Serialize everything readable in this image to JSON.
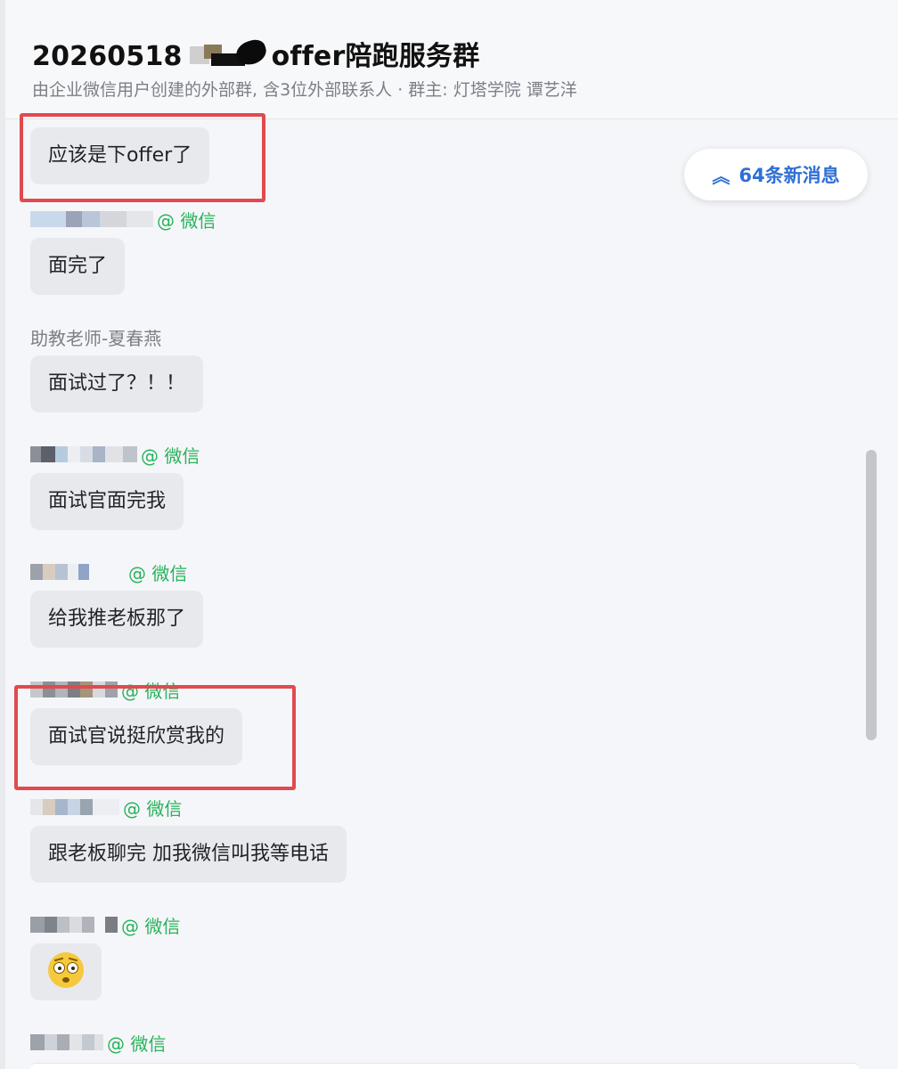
{
  "header": {
    "title_prefix": "20260518",
    "title_suffix": "offer陪跑服务群",
    "subtitle": "由企业微信用户创建的外部群, 含3位外部联系人 · 群主: 灯塔学院 谭艺洋"
  },
  "new_messages_button": {
    "label": "64条新消息",
    "icon": "double-chevron-up-icon"
  },
  "messages": [
    {
      "sender": "",
      "tag": "",
      "text": "应该是下offer了"
    },
    {
      "sender": "",
      "tag": "@ 微信",
      "text": "面完了"
    },
    {
      "sender": "助教老师-夏春燕",
      "tag": "",
      "text": "面试过了？！！"
    },
    {
      "sender": "",
      "tag": "@ 微信",
      "text": "面试官面完我"
    },
    {
      "sender": "",
      "tag": "@ 微信",
      "text": "给我推老板那了"
    },
    {
      "sender": "",
      "tag": "@ 微信",
      "text": "面试官说挺欣赏我的"
    },
    {
      "sender": "",
      "tag": "@ 微信",
      "text": "跟老板聊完 加我微信叫我等电话"
    },
    {
      "sender": "",
      "tag": "@ 微信",
      "text": "",
      "emoji": "flushed-face-icon"
    },
    {
      "sender": "",
      "tag": "@ 微信",
      "text": ""
    }
  ],
  "colors": {
    "highlight": "#e04a4f",
    "wechat_tag": "#27b35a",
    "accent": "#2f6fd6",
    "bubble": "#e8e9ec"
  }
}
